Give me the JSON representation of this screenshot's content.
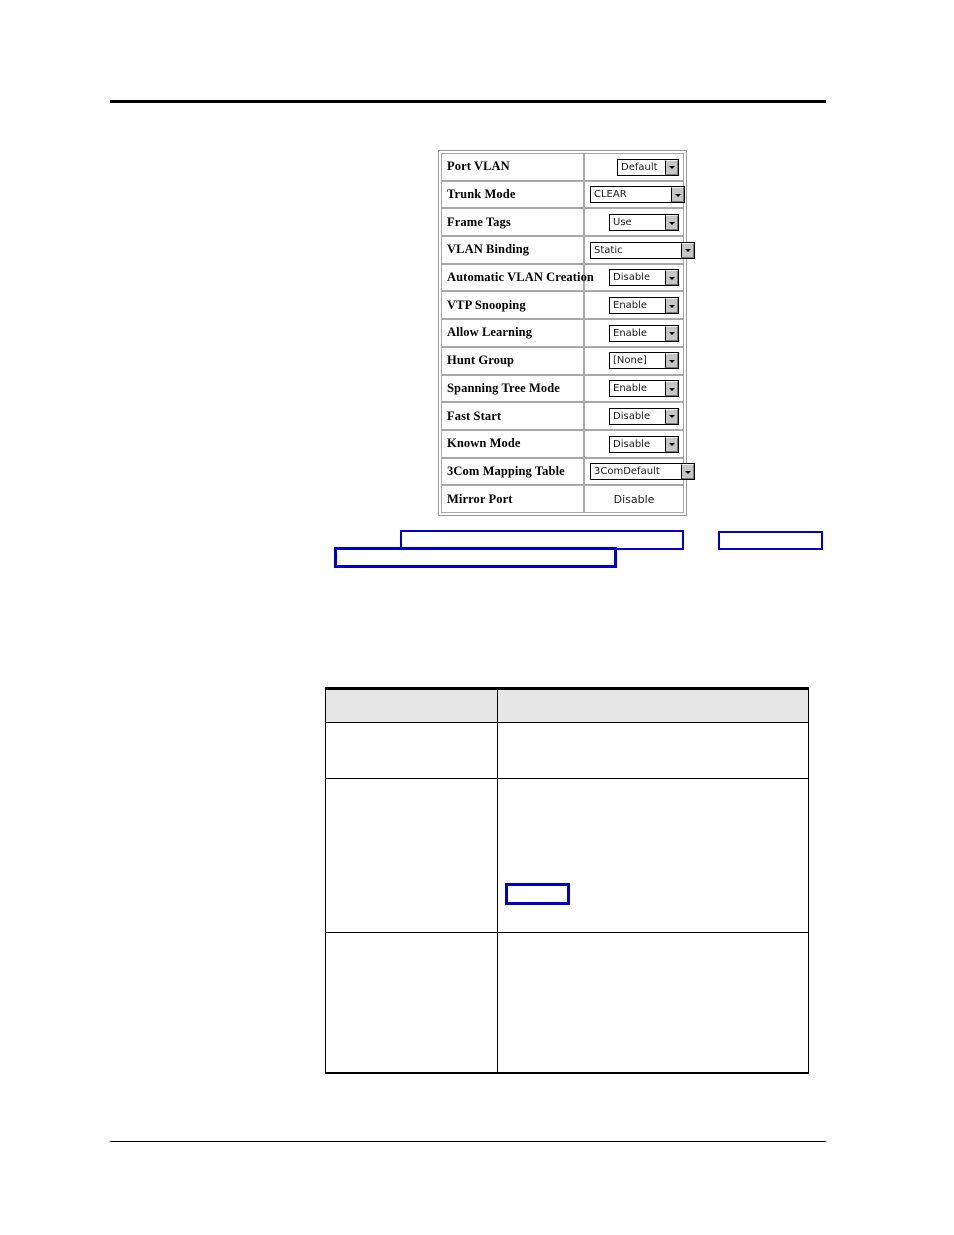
{
  "page": {
    "background_color": "#ffffff",
    "rule_color": "#000000",
    "blue_outline_color": "#0000cc",
    "header_rule": "",
    "footer_rule": ""
  },
  "screenshot_panel": {
    "name": "vlan-port-settings",
    "rows": [
      {
        "label": "Port VLAN",
        "value": "Default",
        "control": "dropdown",
        "width": "w-narrow"
      },
      {
        "label": "Trunk Mode",
        "value": "CLEAR",
        "control": "dropdown",
        "width": "w-wide"
      },
      {
        "label": "Frame Tags",
        "value": "Use",
        "control": "dropdown",
        "width": "w-mid"
      },
      {
        "label": "VLAN Binding",
        "value": "Static",
        "control": "dropdown",
        "width": "w-xwide"
      },
      {
        "label": "Automatic VLAN Creation",
        "value": "Disable",
        "control": "dropdown",
        "width": "w-mid"
      },
      {
        "label": "VTP Snooping",
        "value": "Enable",
        "control": "dropdown",
        "width": "w-mid"
      },
      {
        "label": "Allow Learning",
        "value": "Enable",
        "control": "dropdown",
        "width": "w-mid"
      },
      {
        "label": "Hunt Group",
        "value": "[None]",
        "control": "dropdown",
        "width": "w-mid"
      },
      {
        "label": "Spanning Tree Mode",
        "value": "Enable",
        "control": "dropdown",
        "width": "w-mid"
      },
      {
        "label": "Fast Start",
        "value": "Disable",
        "control": "dropdown",
        "width": "w-mid"
      },
      {
        "label": "Known Mode",
        "value": "Disable",
        "control": "dropdown",
        "width": "w-mid"
      },
      {
        "label": "3Com Mapping Table",
        "value": "3ComDefault",
        "control": "dropdown",
        "width": "w-xwide"
      },
      {
        "label": "Mirror Port",
        "value": "Disable",
        "control": "text",
        "width": ""
      }
    ]
  },
  "caption_boxes": {
    "box_a": "",
    "box_b": "",
    "box_c": "",
    "box_d": ""
  },
  "description_table": {
    "headers": [
      "",
      ""
    ],
    "rows": [
      {
        "cells": [
          "",
          ""
        ]
      },
      {
        "cells": [
          "",
          ""
        ]
      },
      {
        "cells": [
          "",
          ""
        ]
      }
    ]
  }
}
